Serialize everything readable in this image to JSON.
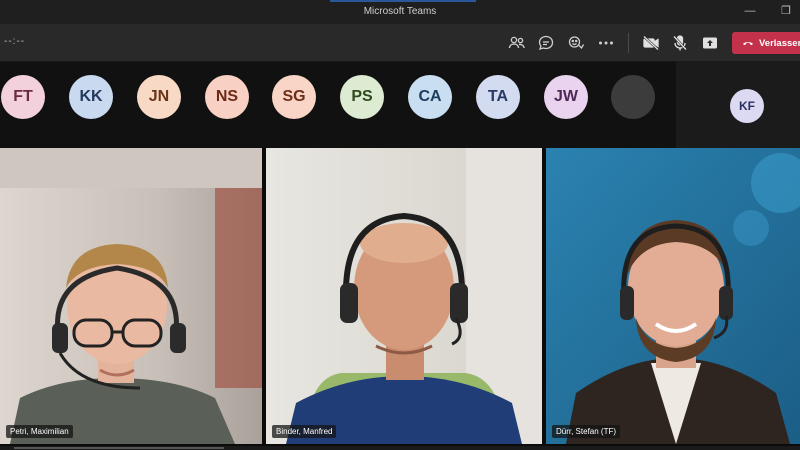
{
  "window": {
    "title": "Microsoft Teams",
    "restore_glyph": "❐",
    "minimize_glyph": "—"
  },
  "meeting_bar": {
    "timer": "--:--",
    "leave_label": "Verlassen",
    "icons": [
      "participants-icon",
      "chat-icon",
      "reactions-icon",
      "more-icon",
      "camera-off-icon",
      "mic-off-icon",
      "share-icon",
      "phone-hangup-icon"
    ]
  },
  "avatars": [
    {
      "initials": "FT",
      "bg": "#f3d1dc",
      "fg": "#6b2c3f"
    },
    {
      "initials": "KK",
      "bg": "#c9d9ef",
      "fg": "#233a5e"
    },
    {
      "initials": "JN",
      "bg": "#f8d9c6",
      "fg": "#6a3418"
    },
    {
      "initials": "NS",
      "bg": "#f8d0c4",
      "fg": "#6d2a17"
    },
    {
      "initials": "SG",
      "bg": "#f8d5c6",
      "fg": "#6d2e19"
    },
    {
      "initials": "PS",
      "bg": "#dcebd2",
      "fg": "#2f4a1e"
    },
    {
      "initials": "CA",
      "bg": "#c9dff1",
      "fg": "#1f3d5e"
    },
    {
      "initials": "TA",
      "bg": "#d2dbf0",
      "fg": "#283a64"
    },
    {
      "initials": "JW",
      "bg": "#ead3ee",
      "fg": "#4e2a5a"
    },
    {
      "initials": "",
      "bg": "#3c3c3c",
      "fg": "#3c3c3c"
    }
  ],
  "pinned_avatar": {
    "initials": "KF",
    "bg": "#dcdaf3",
    "fg": "#2c2f63"
  },
  "videos": [
    {
      "name": "Petri, Maximilian",
      "bg1": "#d9d4cf",
      "bg2": "#b9b3ad"
    },
    {
      "name": "Binder, Manfred",
      "bg1": "#e2e0da",
      "bg2": "#cfcbc3"
    },
    {
      "name": "Dürr, Stefan (TF)",
      "bg1": "#2a79a6",
      "bg2": "#1d5f86"
    }
  ],
  "colors": {
    "accent": "#7f85f5",
    "leave": "#c4314b"
  }
}
